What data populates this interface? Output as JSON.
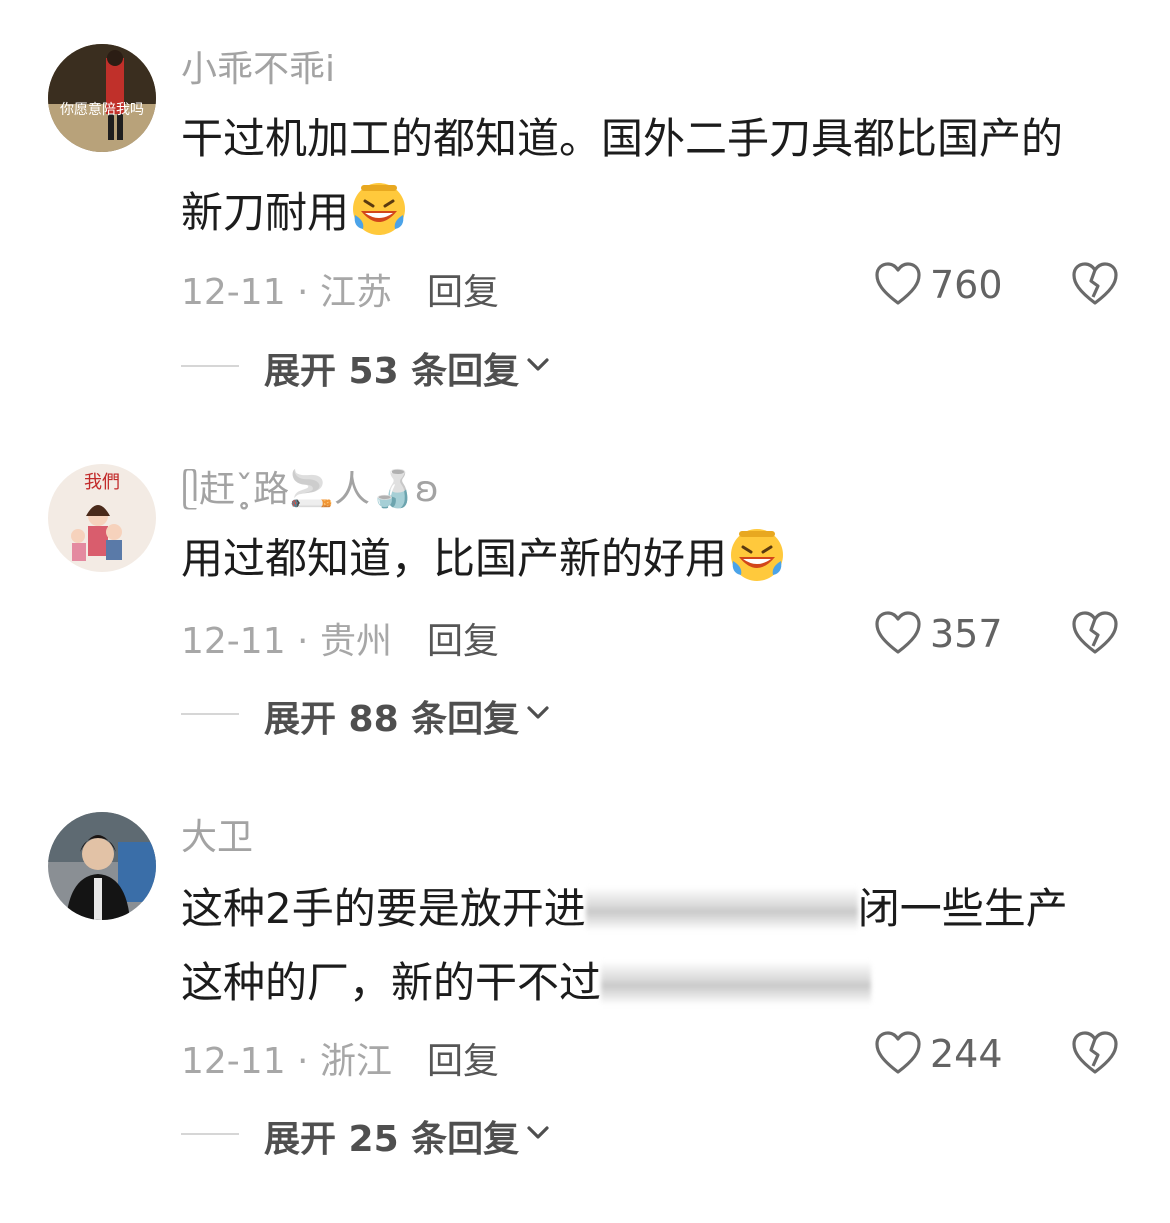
{
  "comments": [
    {
      "username": "小乖不乖i",
      "avatar_text": "你愿意陪我吗",
      "content_line1": "干过机加工的都知道。国外二手刀具都比国产的",
      "content_line2": "新刀耐用",
      "emoji": "laughing-crying-emoji",
      "date_location": "12-11 · 江苏",
      "reply_label": "回复",
      "like_count": "760",
      "expand_label": "展开 53 条回复"
    },
    {
      "username": "ᥫ赶ˇ̥̥̥路🚬人🍶ʚ",
      "avatar_text": "我們",
      "content_line1": "用过都知道，比国产新的好用",
      "emoji": "laughing-crying-emoji",
      "date_location": "12-11 · 贵州",
      "reply_label": "回复",
      "like_count": "357",
      "expand_label": "展开 88 条回复"
    },
    {
      "username": "大卫",
      "content_line1_start": "这种2手的要是放开进",
      "content_line1_end": "闭一些生产",
      "content_line2_start": "这种的厂，新的干不过",
      "date_location": "12-11 · 浙江",
      "reply_label": "回复",
      "like_count": "244",
      "expand_label": "展开 25 条回复"
    }
  ],
  "icons": {
    "like": "heart-outline-icon",
    "dislike": "broken-heart-icon",
    "expand": "chevron-down-icon"
  },
  "colors": {
    "username": "#a3a3a3",
    "content": "#1c1c1c",
    "meta": "#a7a7a7",
    "reply": "#565656"
  }
}
